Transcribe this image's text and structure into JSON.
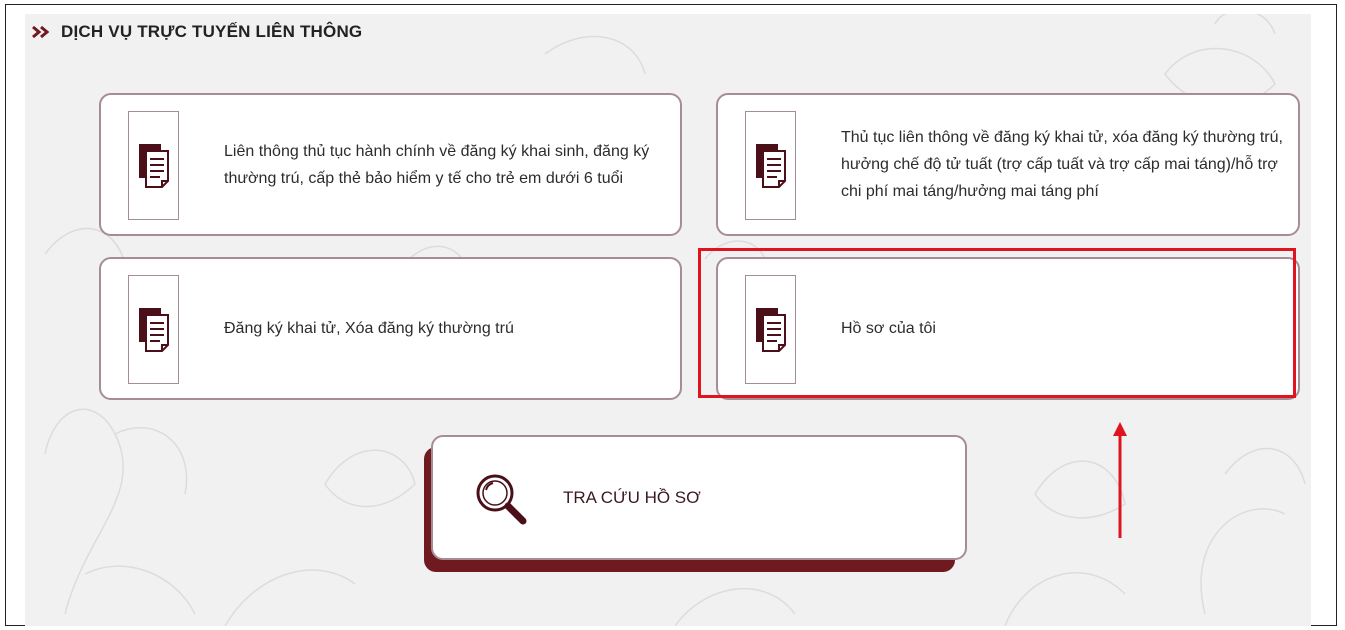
{
  "section": {
    "title": "DỊCH VỤ TRỰC TUYẾN LIÊN THÔNG",
    "chevron_icon": "double-chevron-right-icon"
  },
  "cards": [
    {
      "label": "Liên thông thủ tục hành chính về đăng ký khai sinh, đăng ký thường trú, cấp thẻ bảo hiểm y tế cho trẻ em dưới 6 tuổi",
      "icon": "document-icon"
    },
    {
      "label": "Thủ tục liên thông về đăng ký khai tử, xóa đăng ký thường trú, hưởng chế độ tử tuất (trợ cấp tuất và trợ cấp mai táng)/hỗ trợ chi phí mai táng/hưởng mai táng phí",
      "icon": "document-icon"
    },
    {
      "label": "Đăng ký khai tử, Xóa đăng ký thường trú",
      "icon": "document-icon"
    },
    {
      "label": "Hồ sơ của tôi",
      "icon": "document-icon"
    }
  ],
  "lookup": {
    "label": "TRA CỨU HỒ SƠ",
    "icon": "magnifier-icon"
  },
  "colors": {
    "accent": "#6e1a1f",
    "card_border": "#a58c96",
    "highlight": "#e0141e",
    "panel_bg": "#f1f1f1"
  }
}
